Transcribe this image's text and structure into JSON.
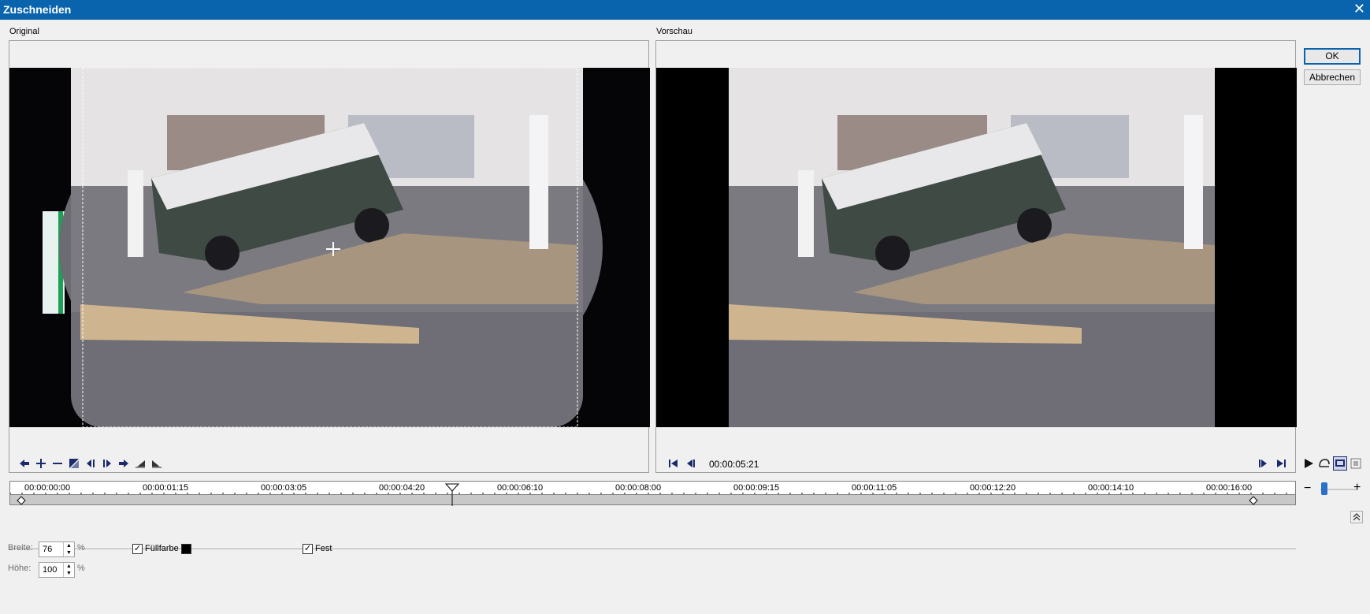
{
  "window": {
    "title": "Zuschneiden",
    "close_glyph": "✕"
  },
  "original_panel": {
    "label": "Original"
  },
  "preview_panel": {
    "label": "Vorschau"
  },
  "buttons": {
    "ok": "OK",
    "cancel": "Abbrechen"
  },
  "toolbar_left": [
    {
      "name": "move-left-icon"
    },
    {
      "name": "add-keyframe-icon"
    },
    {
      "name": "remove-keyframe-icon"
    },
    {
      "name": "split-icon"
    },
    {
      "name": "prev-keyframe-icon"
    },
    {
      "name": "next-keyframe-icon"
    },
    {
      "name": "move-right-icon"
    },
    {
      "name": "ease-in-icon"
    },
    {
      "name": "ease-out-icon"
    }
  ],
  "transport": {
    "timecode": "00:00:05:21"
  },
  "timeline": {
    "ticks": [
      "00:00:00:00",
      "00:00:01:15",
      "00:00:03:05",
      "00:00:04:20",
      "00:00:06:10",
      "00:00:08:00",
      "00:00:09:15",
      "00:00:11:05",
      "00:00:12:20",
      "00:00:14:10",
      "00:00:16:00"
    ],
    "playhead_fraction": 0.344,
    "keyframes_fraction": [
      0.009,
      0.968
    ]
  },
  "zoom": {
    "minus": "−",
    "plus": "+"
  },
  "properties": {
    "width_label": "Breite:",
    "width_value": "76",
    "height_label": "Höhe:",
    "height_value": "100",
    "percent": "%",
    "fill_label": "Füllfarbe",
    "fill_checked": "✓",
    "fill_color": "#000000",
    "fixed_label": "Fest",
    "fixed_checked": "✓"
  }
}
